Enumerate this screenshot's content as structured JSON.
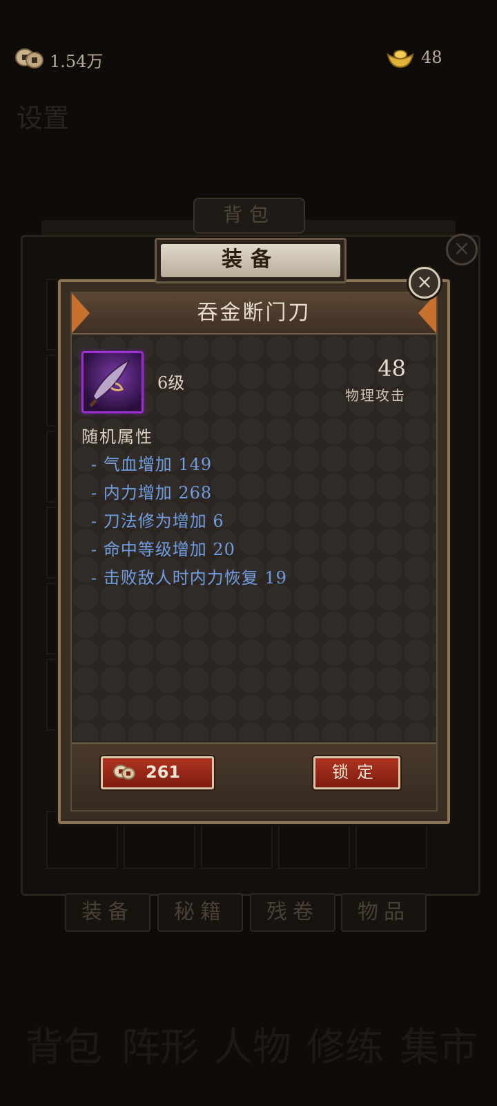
{
  "top_bar": {
    "coins": "1.54万",
    "ingots": "48"
  },
  "background": {
    "panel_title": "背包",
    "tabs": [
      "装备",
      "秘籍",
      "残卷",
      "物品"
    ],
    "nav": [
      "背包",
      "阵形",
      "人物",
      "修练",
      "集市"
    ],
    "corner_text": "设置"
  },
  "dialog": {
    "header": "装备",
    "item_name": "吞金断门刀",
    "level": "6级",
    "stat_value": "48",
    "stat_label": "物理攻击",
    "random_attr_title": "随机属性",
    "attributes": [
      "- 气血增加 149",
      "- 内力增加 268",
      "- 刀法修为增加 6",
      "- 命中等级增加 20",
      "- 击败敌人时内力恢复 19"
    ],
    "cost": "261",
    "lock_label": "锁定"
  },
  "colors": {
    "attribute_text": "#6f9de0",
    "rarity_border": "#9b2fd0",
    "button_red": "#b0321f"
  }
}
